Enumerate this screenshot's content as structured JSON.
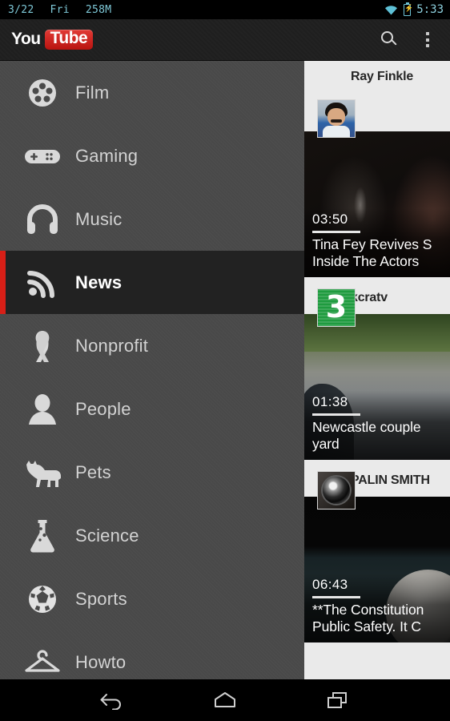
{
  "status_bar": {
    "date": "3/22",
    "day": "Fri",
    "memory": "258M",
    "time": "5:33",
    "wifi_icon": "wifi-icon",
    "battery_icon": "battery-charging-icon",
    "text_color": "#7fc9d8"
  },
  "action_bar": {
    "logo_you": "You",
    "logo_tube": "Tube",
    "logo_red": "#c41a14",
    "search_icon": "search-icon",
    "overflow_icon": "overflow-menu-icon"
  },
  "sidebar": {
    "accent_color": "#d71f17",
    "selected_index": 3,
    "items": [
      {
        "label": "Film",
        "icon": "film-reel-icon",
        "selected": false
      },
      {
        "label": "Gaming",
        "icon": "gamepad-icon",
        "selected": false
      },
      {
        "label": "Music",
        "icon": "headphones-icon",
        "selected": false
      },
      {
        "label": "News",
        "icon": "rss-feed-icon",
        "selected": true
      },
      {
        "label": "Nonprofit",
        "icon": "ribbon-icon",
        "selected": false
      },
      {
        "label": "People",
        "icon": "person-icon",
        "selected": false
      },
      {
        "label": "Pets",
        "icon": "dog-icon",
        "selected": false
      },
      {
        "label": "Science",
        "icon": "flask-icon",
        "selected": false
      },
      {
        "label": "Sports",
        "icon": "soccer-ball-icon",
        "selected": false
      },
      {
        "label": "Howto",
        "icon": "hanger-icon",
        "selected": false
      }
    ]
  },
  "content": {
    "cards": [
      {
        "channel": "Ray Finkle",
        "avatar": "channel-avatar-person",
        "duration": "03:50",
        "title_line1": "Tina Fey Revives S",
        "title_line2": "Inside The Actors"
      },
      {
        "channel": "kcratv",
        "avatar": "channel-avatar-kcra3",
        "avatar_text": "3",
        "duration": "01:38",
        "title_line1": "Newcastle couple",
        "title_line2": "yard"
      },
      {
        "channel": "PALIN SMITH",
        "avatar": "channel-avatar-camera",
        "duration": "06:43",
        "title_line1": "**The Constitution",
        "title_line2": "Public Safety.  It C"
      }
    ]
  },
  "nav_bar": {
    "back_icon": "back-arrow-icon",
    "home_icon": "home-icon",
    "recents_icon": "recent-apps-icon"
  }
}
